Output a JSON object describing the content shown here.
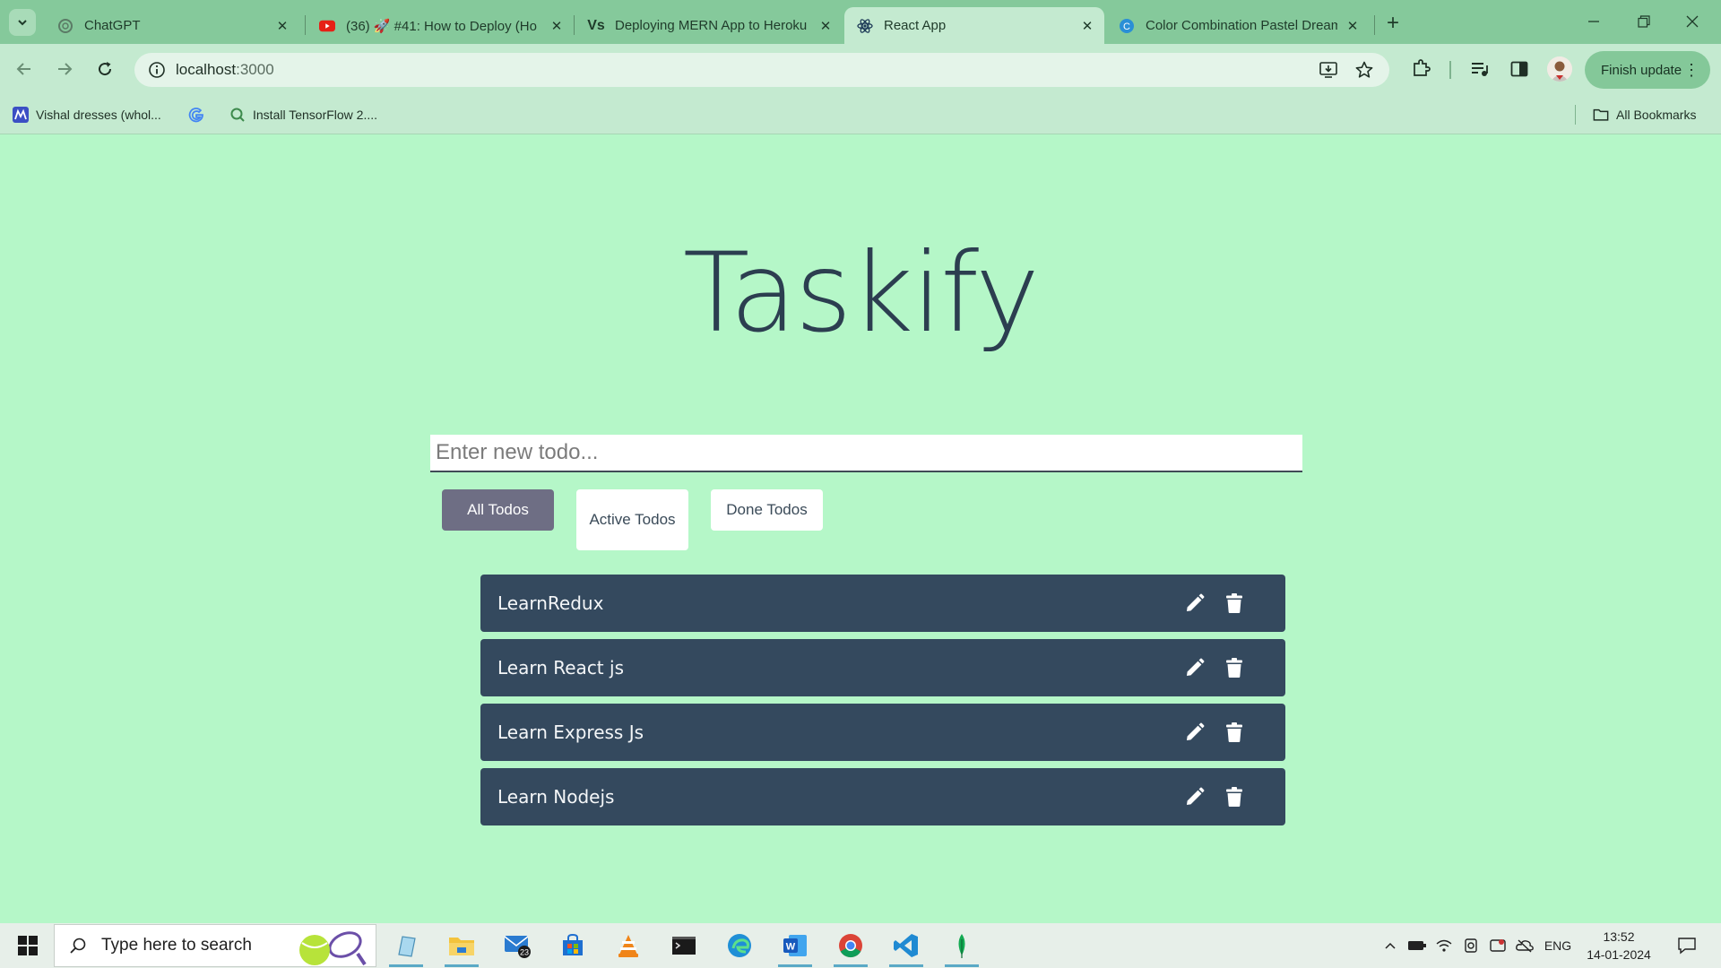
{
  "browser": {
    "tabs": [
      {
        "label": "ChatGPT",
        "icon": "chatgpt-icon",
        "active": false
      },
      {
        "label": "(36) 🚀 #41: How to Deploy (Ho",
        "icon": "youtube-icon",
        "active": false
      },
      {
        "label": "Deploying MERN App to Heroku",
        "icon": "vs-icon",
        "active": false
      },
      {
        "label": "React App",
        "icon": "react-icon",
        "active": true
      },
      {
        "label": "Color Combination Pastel Dream",
        "icon": "canva-icon",
        "active": false
      }
    ],
    "url_host": "localhost",
    "url_port": ":3000",
    "finish_update_label": "Finish update",
    "bookmarks": [
      {
        "label": "Vishal dresses (whol..."
      },
      {
        "label": ""
      },
      {
        "label": "Install TensorFlow 2...."
      }
    ],
    "all_bookmarks_label": "All Bookmarks"
  },
  "app": {
    "title": "Taskify",
    "input_placeholder": "Enter new todo...",
    "filters": [
      {
        "label": "All Todos",
        "selected": true
      },
      {
        "label": "Active Todos",
        "selected": false
      },
      {
        "label": "Done Todos",
        "selected": false
      }
    ],
    "todos": [
      {
        "text": "LearnRedux"
      },
      {
        "text": "Learn React js"
      },
      {
        "text": "Learn Express Js"
      },
      {
        "text": "Learn Nodejs"
      }
    ]
  },
  "taskbar": {
    "search_placeholder": "Type here to search",
    "mail_badge": "23",
    "language": "ENG",
    "time": "13:52",
    "date": "14-01-2024"
  },
  "colors": {
    "page_bg": "#b5f7c8",
    "todo_bg": "#34495e",
    "selected_filter": "#6e6e84",
    "title": "#2c3e50"
  }
}
